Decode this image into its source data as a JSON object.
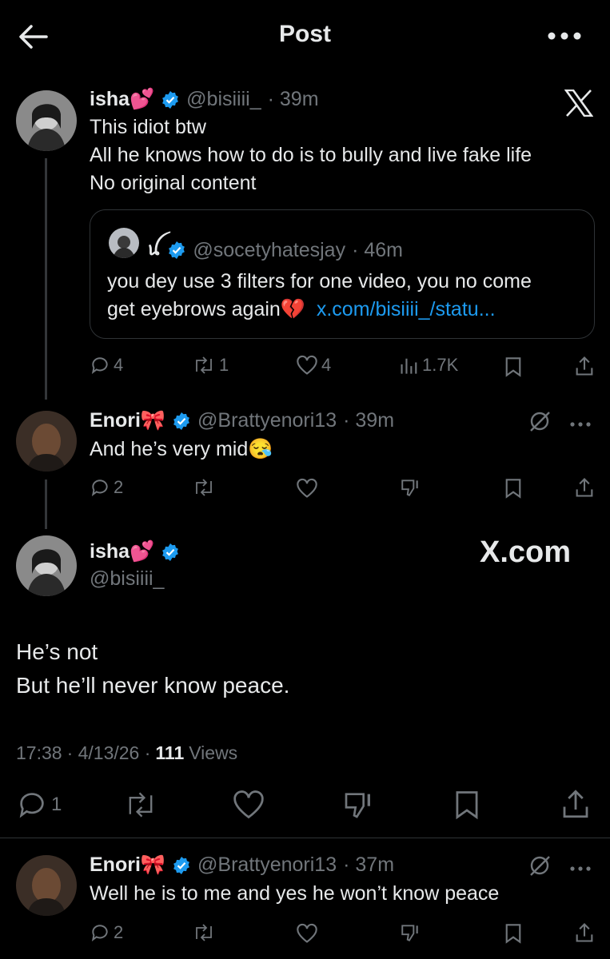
{
  "header": {
    "title": "Post"
  },
  "reply_parent": {
    "name": "isha💕",
    "handle": "@bisiiii_",
    "time": "· 39m",
    "lines": [
      "This idiot btw",
      "All he knows how to do is to bully and live fake life",
      "No original content"
    ],
    "quote": {
      "name": "ꪊ",
      "handle": "@socetyhatesjay",
      "time": "· 46m",
      "line1": "you dey use 3 filters for one video, you no come",
      "line2": "get eyebrows again💔",
      "link": "x.com/bisiiii_/statu..."
    },
    "actions": {
      "replies": "4",
      "reposts": "1",
      "likes": "4",
      "views": "1.7K"
    }
  },
  "reply_one": {
    "name": "Enori🎀",
    "handle": "@Brattyenori13",
    "time": "· 39m",
    "text": "And he’s very mid😪",
    "actions": {
      "replies": "2"
    }
  },
  "main_post": {
    "name": "isha💕",
    "handle": "@bisiiii_",
    "watermark": "X.com",
    "line1": "He’s not",
    "line2": "But he’ll never know peace.",
    "time": "17:38",
    "date": "· 4/13/26 ·",
    "views_count": "111",
    "views_label": "Views",
    "actions": {
      "replies": "1"
    }
  },
  "reply_two": {
    "name": "Enori🎀",
    "handle": "@Brattyenori13",
    "time": "· 37m",
    "text": "Well he is to me and yes he won’t know peace",
    "actions": {
      "replies": "2"
    }
  },
  "colors": {
    "background": "#000000",
    "text": "#e7e9ea",
    "muted": "#71767b",
    "link": "#1d9bf0",
    "verified": "#1d9bf0"
  }
}
